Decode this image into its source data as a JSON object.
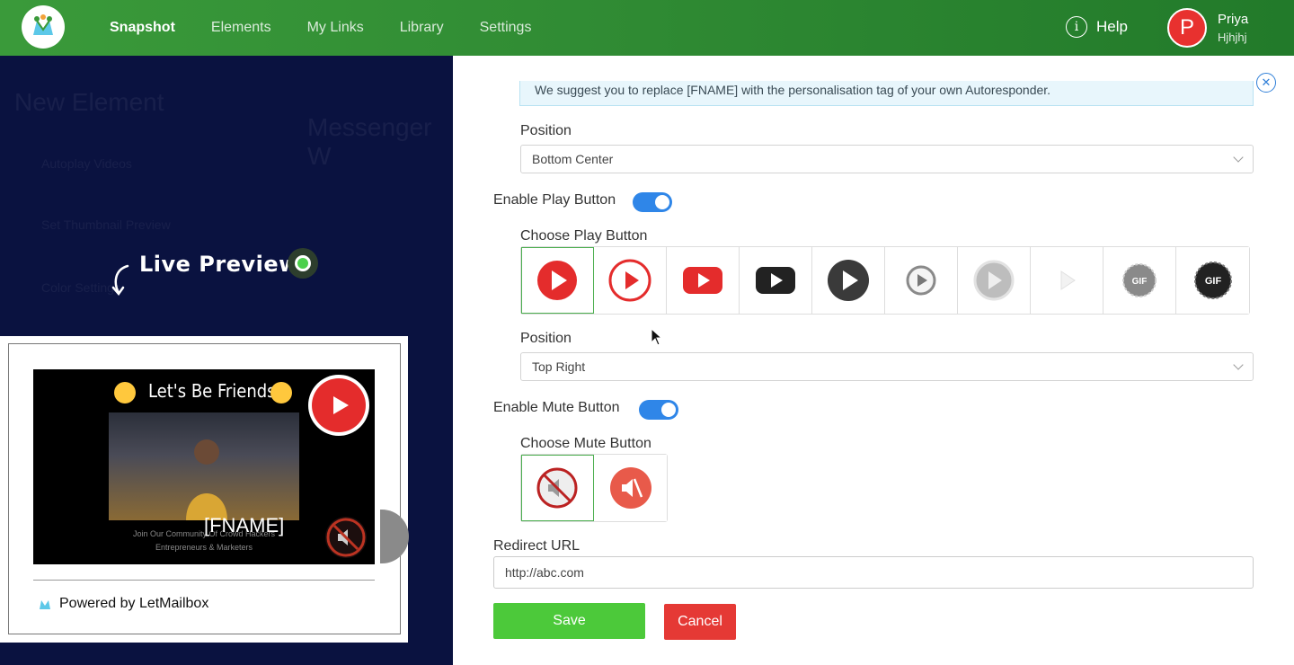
{
  "nav": {
    "items": [
      "Snapshot",
      "Elements",
      "My Links",
      "Library",
      "Settings"
    ],
    "active": "Snapshot",
    "help_label": "Help",
    "help_icon": "i"
  },
  "user": {
    "initial": "P",
    "name": "Priya",
    "subtitle": "Hjhjhj"
  },
  "background": {
    "title": "New Element",
    "subtitle": "Messenger W",
    "row1": "Autoplay Videos",
    "row2": "Set Thumbnail Preview",
    "row3": "Color Settings"
  },
  "preview": {
    "live_label": "Live Preview",
    "video_title": "Let's Be Friends!",
    "video_fname": "[FNAME]",
    "video_caption_1": "Join Our Community Of Crowd Hackers",
    "video_caption_2": "Entrepreneurs & Marketers",
    "powered_by": "Powered by LetMailbox"
  },
  "form": {
    "alert_text": "We suggest you to replace [FNAME] with the personalisation tag of your own Autoresponder.",
    "position_label_1": "Position",
    "position_value_1": "Bottom Center",
    "enable_play_label": "Enable Play Button",
    "enable_play": true,
    "choose_play_label": "Choose Play Button",
    "play_buttons": [
      "red-circle-play",
      "red-outline-play",
      "youtube-red-play",
      "youtube-black-play",
      "dark-circle-play",
      "grey-ring-play",
      "light-grey-play",
      "white-faint-play",
      "grey-gif",
      "black-gif"
    ],
    "position_label_2": "Position",
    "position_value_2": "Top Right",
    "enable_mute_label": "Enable Mute Button",
    "enable_mute": true,
    "choose_mute_label": "Choose Mute Button",
    "mute_buttons": [
      "mute-strike-icon",
      "mute-red-icon"
    ],
    "redirect_label": "Redirect URL",
    "redirect_value": "http://abc.com",
    "save_label": "Save",
    "cancel_label": "Cancel",
    "gif_text": "GIF"
  },
  "colors": {
    "nav_green": "#2f8a33",
    "accent_blue": "#2f86e8",
    "save_green": "#4cc93a",
    "cancel_red": "#e53935",
    "play_red": "#e42c2c"
  }
}
